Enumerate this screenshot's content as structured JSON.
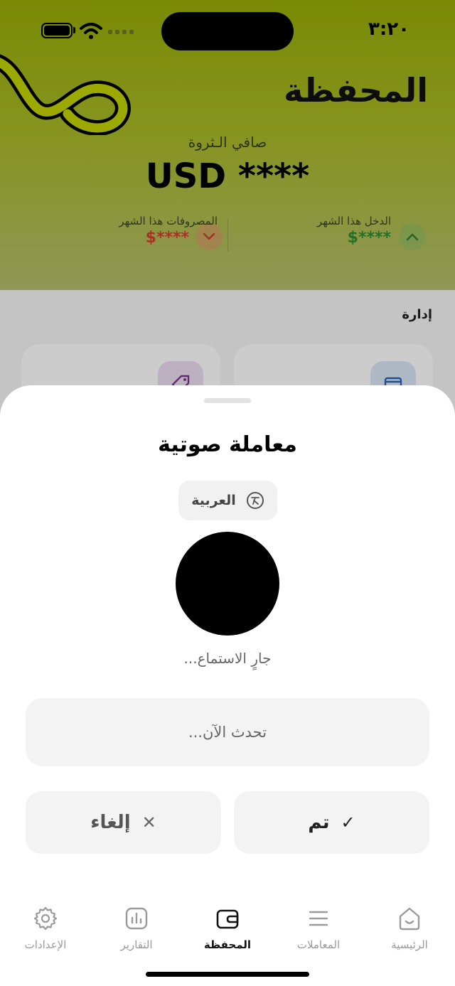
{
  "status_bar": {
    "time": "٣:٢٠"
  },
  "header": {
    "title": "المحفظة",
    "net_worth_label": "صافي الـثروة",
    "net_worth_value": "USD ****",
    "income": {
      "label": "الدخل هذا الشهر",
      "value": "$****"
    },
    "expenses": {
      "label": "المصروفات هذا الشهر",
      "value": "$****"
    }
  },
  "manage": {
    "section_label": "إدارة"
  },
  "sheet": {
    "title": "معاملة صوتية",
    "language": "العربية",
    "status": "جارٍ الاستماع...",
    "transcript_placeholder": "تحدث الآن...",
    "cancel_label": "إلغاء",
    "done_label": "تم"
  },
  "tabs": [
    {
      "label": "الرئيسية",
      "icon": "home-icon"
    },
    {
      "label": "المعاملات",
      "icon": "list-icon"
    },
    {
      "label": "المحفظة",
      "icon": "wallet-icon",
      "active": true
    },
    {
      "label": "التقارير",
      "icon": "chart-icon"
    },
    {
      "label": "الإعدادات",
      "icon": "gear-icon"
    }
  ],
  "colors": {
    "brand": "#98ad07",
    "income": "#2f8d34",
    "expense": "#d93b2f"
  }
}
